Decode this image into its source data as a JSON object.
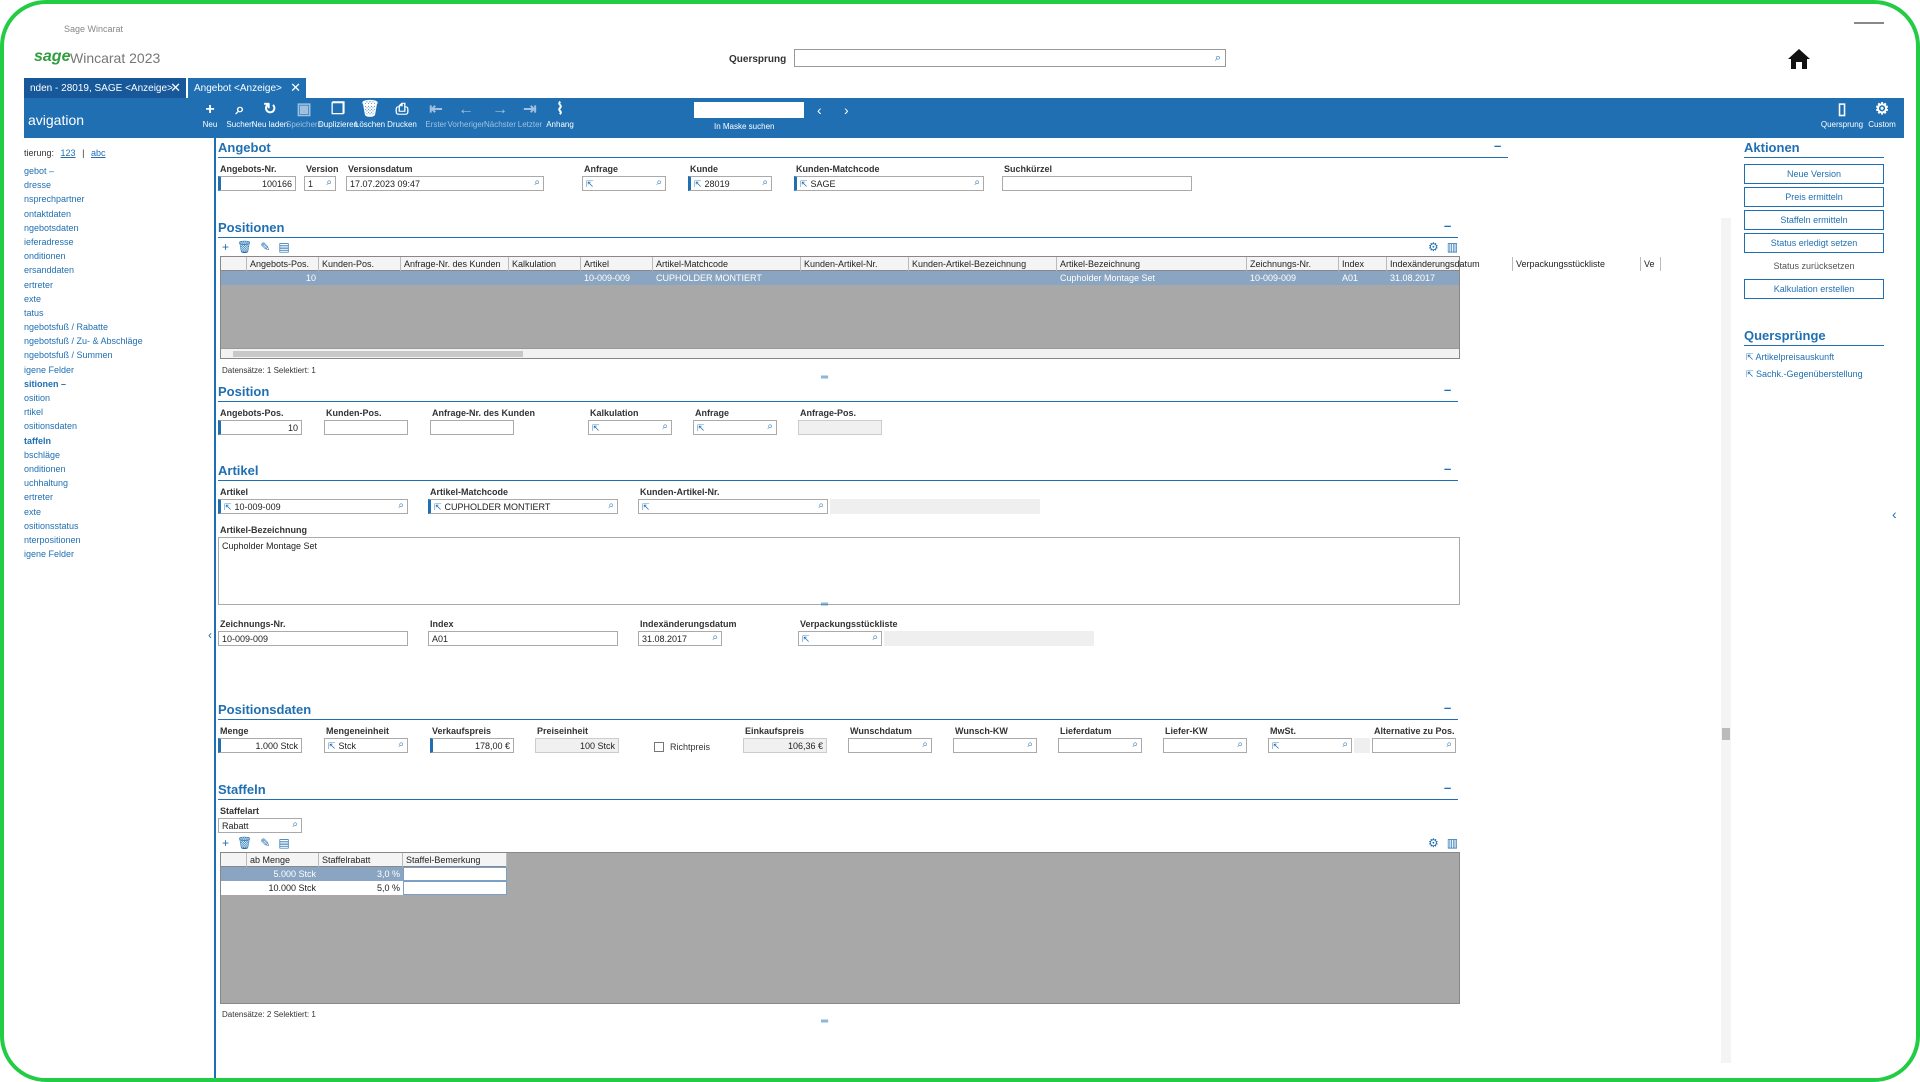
{
  "window": {
    "title": "Sage Wincarat"
  },
  "header": {
    "logo": "sage",
    "app_name": "Wincarat 2023",
    "quersprung_label": "Quersprung",
    "quersprung_value": ""
  },
  "tabs": [
    {
      "label": "nden - 28019, SAGE <Anzeige>"
    },
    {
      "label": "Angebot <Anzeige>"
    }
  ],
  "toolbar": {
    "nav_title": "avigation",
    "buttons": [
      {
        "label": "Neu",
        "icon": "plus-icon",
        "glyph": "+"
      },
      {
        "label": "Suchen",
        "icon": "search-icon",
        "glyph": "⌕"
      },
      {
        "label": "Neu laden",
        "icon": "reload-icon",
        "glyph": "↻"
      },
      {
        "label": "Speichern",
        "icon": "save-icon",
        "glyph": "▣"
      },
      {
        "label": "Duplizieren",
        "icon": "duplicate-icon",
        "glyph": "❐"
      },
      {
        "label": "Löschen",
        "icon": "trash-icon",
        "glyph": "🗑"
      },
      {
        "label": "Drucken",
        "icon": "print-icon",
        "glyph": "⎙"
      },
      {
        "label": "Erster",
        "icon": "first-icon",
        "glyph": "⇤"
      },
      {
        "label": "Vorheriger",
        "icon": "previous-icon",
        "glyph": "←"
      },
      {
        "label": "Nächster",
        "icon": "next-icon",
        "glyph": "→"
      },
      {
        "label": "Letzter",
        "icon": "last-icon",
        "glyph": "⇥"
      },
      {
        "label": "Anhang",
        "icon": "paperclip-icon",
        "glyph": "⌇"
      }
    ],
    "mask_search_label": "In Maske suchen",
    "mask_search_value": "",
    "right_buttons": [
      {
        "label": "Quersprung",
        "icon": "quersprung-icon",
        "glyph": "▯"
      },
      {
        "label": "Custom",
        "icon": "gear-icon",
        "glyph": "⚙"
      }
    ]
  },
  "nav": {
    "sort_label": "tierung:",
    "sort_123": "123",
    "sort_sep": "|",
    "sort_abc": "abc",
    "items": [
      {
        "label": "gebot –",
        "bold": false
      },
      {
        "label": "dresse",
        "bold": false
      },
      {
        "label": "nsprechpartner",
        "bold": false
      },
      {
        "label": "ontaktdaten",
        "bold": false
      },
      {
        "label": "ngebotsdaten",
        "bold": false
      },
      {
        "label": "ieferadresse",
        "bold": false
      },
      {
        "label": "onditionen",
        "bold": false
      },
      {
        "label": "ersanddaten",
        "bold": false
      },
      {
        "label": "ertreter",
        "bold": false
      },
      {
        "label": "exte",
        "bold": false
      },
      {
        "label": "tatus",
        "bold": false
      },
      {
        "label": "ngebotsfuß / Rabatte",
        "bold": false
      },
      {
        "label": "ngebotsfuß / Zu- & Abschläge",
        "bold": false
      },
      {
        "label": "ngebotsfuß / Summen",
        "bold": false
      },
      {
        "label": "igene Felder",
        "bold": false
      },
      {
        "label": "sitionen –",
        "bold": true
      },
      {
        "label": "osition",
        "bold": false
      },
      {
        "label": "rtikel",
        "bold": false
      },
      {
        "label": "ositionsdaten",
        "bold": false
      },
      {
        "label": "taffeln",
        "bold": true
      },
      {
        "label": "bschläge",
        "bold": false
      },
      {
        "label": "onditionen",
        "bold": false
      },
      {
        "label": "uchhaltung",
        "bold": false
      },
      {
        "label": "ertreter",
        "bold": false
      },
      {
        "label": "exte",
        "bold": false
      },
      {
        "label": "ositionsstatus",
        "bold": false
      },
      {
        "label": "nterpositionen",
        "bold": false
      },
      {
        "label": "igene Felder",
        "bold": false
      }
    ]
  },
  "angebot": {
    "title": "Angebot",
    "fields": {
      "nr": {
        "label": "Angebots-Nr.",
        "value": "100166"
      },
      "version": {
        "label": "Version",
        "value": "1"
      },
      "versionsdatum": {
        "label": "Versionsdatum",
        "value": "17.07.2023 09:47"
      },
      "anfrage": {
        "label": "Anfrage",
        "value": ""
      },
      "kunde": {
        "label": "Kunde",
        "value": "28019"
      },
      "matchcode": {
        "label": "Kunden-Matchcode",
        "value": "SAGE"
      },
      "suchkuerzel": {
        "label": "Suchkürzel",
        "value": ""
      }
    }
  },
  "positionen": {
    "title": "Positionen",
    "columns": [
      "Angebots-Pos.",
      "Kunden-Pos.",
      "Anfrage-Nr. des Kunden",
      "Kalkulation",
      "Artikel",
      "Artikel-Matchcode",
      "Kunden-Artikel-Nr.",
      "Kunden-Artikel-Bezeichnung",
      "Artikel-Bezeichnung",
      "Zeichnungs-Nr.",
      "Index",
      "Indexänderungsdatum",
      "Verpackungsstückliste",
      "Ve"
    ],
    "rows": [
      [
        "10",
        "",
        "",
        "",
        "10-009-009",
        "CUPHOLDER MONTIERT",
        "",
        "",
        "Cupholder Montage Set",
        "10-009-009",
        "A01",
        "31.08.2017",
        "",
        ""
      ]
    ],
    "count_text": "Datensätze:  1   Selektiert:  1"
  },
  "position": {
    "title": "Position",
    "angebots_pos": {
      "label": "Angebots-Pos.",
      "value": "10"
    },
    "kunden_pos": {
      "label": "Kunden-Pos.",
      "value": ""
    },
    "anfrage_nr": {
      "label": "Anfrage-Nr. des Kunden",
      "value": ""
    },
    "kalkulation": {
      "label": "Kalkulation",
      "value": ""
    },
    "anfrage": {
      "label": "Anfrage",
      "value": ""
    },
    "anfrage_pos": {
      "label": "Anfrage-Pos.",
      "value": ""
    }
  },
  "artikel": {
    "title": "Artikel",
    "artikel": {
      "label": "Artikel",
      "value": "10-009-009"
    },
    "matchcode": {
      "label": "Artikel-Matchcode",
      "value": "CUPHOLDER MONTIERT"
    },
    "kunden_artikel_nr": {
      "label": "Kunden-Artikel-Nr.",
      "value": ""
    },
    "bezeichnung": {
      "label": "Artikel-Bezeichnung",
      "value": "Cupholder Montage Set"
    },
    "zeichnungs_nr": {
      "label": "Zeichnungs-Nr.",
      "value": "10-009-009"
    },
    "index": {
      "label": "Index",
      "value": "A01"
    },
    "index_datum": {
      "label": "Indexänderungsdatum",
      "value": "31.08.2017"
    },
    "verpackung": {
      "label": "Verpackungsstückliste",
      "value": ""
    }
  },
  "positionsdaten": {
    "title": "Positionsdaten",
    "menge": {
      "label": "Menge",
      "value": "1.000 Stck"
    },
    "mengeneinheit": {
      "label": "Mengeneinheit",
      "value": "Stck"
    },
    "verkaufspreis": {
      "label": "Verkaufspreis",
      "value": "178,00 €"
    },
    "preiseinheit": {
      "label": "Preiseinheit",
      "value": "100 Stck"
    },
    "richtpreis": {
      "label": "Richtpreis",
      "checked": false
    },
    "einkaufspreis": {
      "label": "Einkaufspreis",
      "value": "106,36 €"
    },
    "wunschdatum": {
      "label": "Wunschdatum",
      "value": ""
    },
    "wunsch_kw": {
      "label": "Wunsch-KW",
      "value": ""
    },
    "lieferdatum": {
      "label": "Lieferdatum",
      "value": ""
    },
    "liefer_kw": {
      "label": "Liefer-KW",
      "value": ""
    },
    "mwst": {
      "label": "MwSt.",
      "value": ""
    },
    "alternative": {
      "label": "Alternative zu Pos.",
      "value": ""
    }
  },
  "staffeln": {
    "title": "Staffeln",
    "staffelart": {
      "label": "Staffelart",
      "value": "Rabatt"
    },
    "columns": [
      "ab Menge",
      "Staffelrabatt",
      "Staffel-Bemerkung"
    ],
    "rows": [
      [
        "5.000 Stck",
        "3,0 %",
        ""
      ],
      [
        "10.000 Stck",
        "5,0 %",
        ""
      ]
    ],
    "count_text": "Datensätze:  2   Selektiert:  1"
  },
  "aktionen": {
    "title": "Aktionen",
    "buttons": [
      "Neue Version",
      "Preis ermitteln",
      "Staffeln ermitteln",
      "Status erledigt setzen",
      "Status zurücksetzen",
      "Kalkulation erstellen"
    ]
  },
  "quersprunge": {
    "title": "Quersprünge",
    "links": [
      "Artikelpreisauskunft",
      "Sachk.-Gegenüberstellung"
    ]
  },
  "colors": {
    "accent": "#1f6fb2",
    "frame": "#22cc44",
    "brand": "#2e9e3e"
  }
}
